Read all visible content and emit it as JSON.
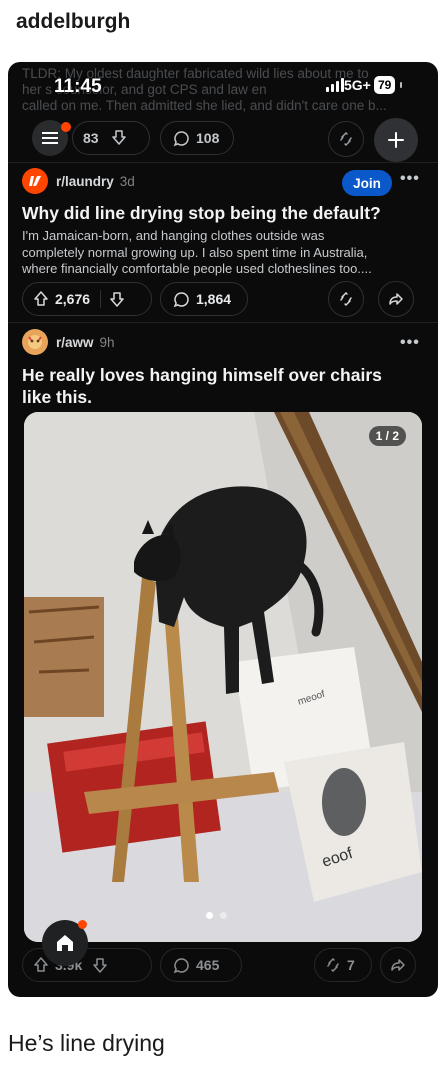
{
  "poster": {
    "username": "addelburgh"
  },
  "status_bar": {
    "time": "11:45",
    "network": "5G+",
    "battery": "79"
  },
  "previous_post": {
    "text_lines": [
      "TLDR: My oldest daughter fabricated wild lies about me to",
      "her s      counselor, and got CPS and law en",
      "called on me. Then admitted she lied, and didn't care one b..."
    ],
    "upvotes": "83",
    "comments": "108"
  },
  "post1": {
    "subreddit": "r/laundry",
    "age": "3d",
    "join_label": "Join",
    "title": "Why did line drying stop being the default?",
    "body_lines": [
      "I'm Jamaican-born, and hanging clothes outside was",
      "completely normal growing up. I also spent time in Australia,",
      "where financially comfortable people used clotheslines too...."
    ],
    "upvotes": "2,676",
    "comments": "1,864"
  },
  "post2": {
    "subreddit": "r/aww",
    "age": "9h",
    "title_lines": [
      "He really loves hanging himself over chairs",
      "like this."
    ],
    "image_counter": "1 / 2",
    "box_text_1": "meoof",
    "box_text_2": "eoof",
    "upvotes": "3.9k",
    "comments": "465",
    "awards": "7"
  },
  "colors": {
    "accent": "#ff4500",
    "join": "#0a58c9",
    "background": "#0b0b0c"
  },
  "icons": [
    "menu-icon",
    "upvote-icon",
    "downvote-icon",
    "comment-icon",
    "award-icon",
    "share-icon",
    "plus-icon",
    "home-icon",
    "more-icon"
  ],
  "caption": "He’s line drying"
}
